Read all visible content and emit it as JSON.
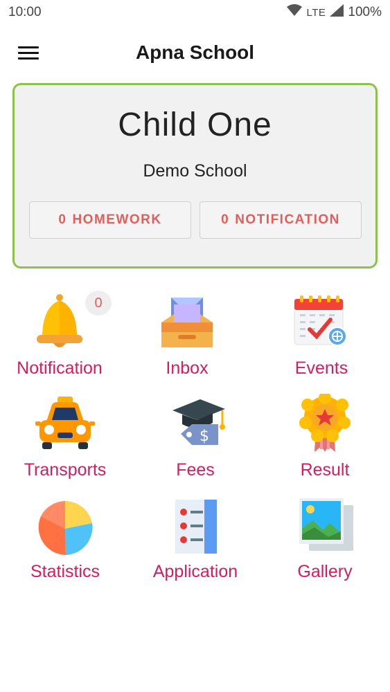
{
  "status_bar": {
    "time": "10:00",
    "network": "LTE",
    "battery": "100%",
    "icons": [
      "wifi-icon",
      "signal-icon",
      "battery-icon"
    ]
  },
  "app_bar": {
    "title": "Apna School",
    "menu_icon": "menu-icon"
  },
  "child_card": {
    "name": "Child One",
    "school": "Demo School",
    "homework": {
      "count": "0",
      "label": "HOMEWORK"
    },
    "notification": {
      "count": "0",
      "label": "NOTIFICATION"
    },
    "border_color": "#8bc34a",
    "button_text_color": "#e35d5b"
  },
  "menu": {
    "notification_badge": "0",
    "items": [
      {
        "label": "Notification",
        "icon": "bell-icon"
      },
      {
        "label": "Inbox",
        "icon": "inbox-icon"
      },
      {
        "label": "Events",
        "icon": "calendar-icon"
      },
      {
        "label": "Transports",
        "icon": "taxi-icon"
      },
      {
        "label": "Fees",
        "icon": "fees-icon"
      },
      {
        "label": "Result",
        "icon": "medal-icon"
      },
      {
        "label": "Statistics",
        "icon": "pie-chart-icon"
      },
      {
        "label": "Application",
        "icon": "list-icon"
      },
      {
        "label": "Gallery",
        "icon": "gallery-icon"
      }
    ],
    "label_color": "#d81b60"
  }
}
